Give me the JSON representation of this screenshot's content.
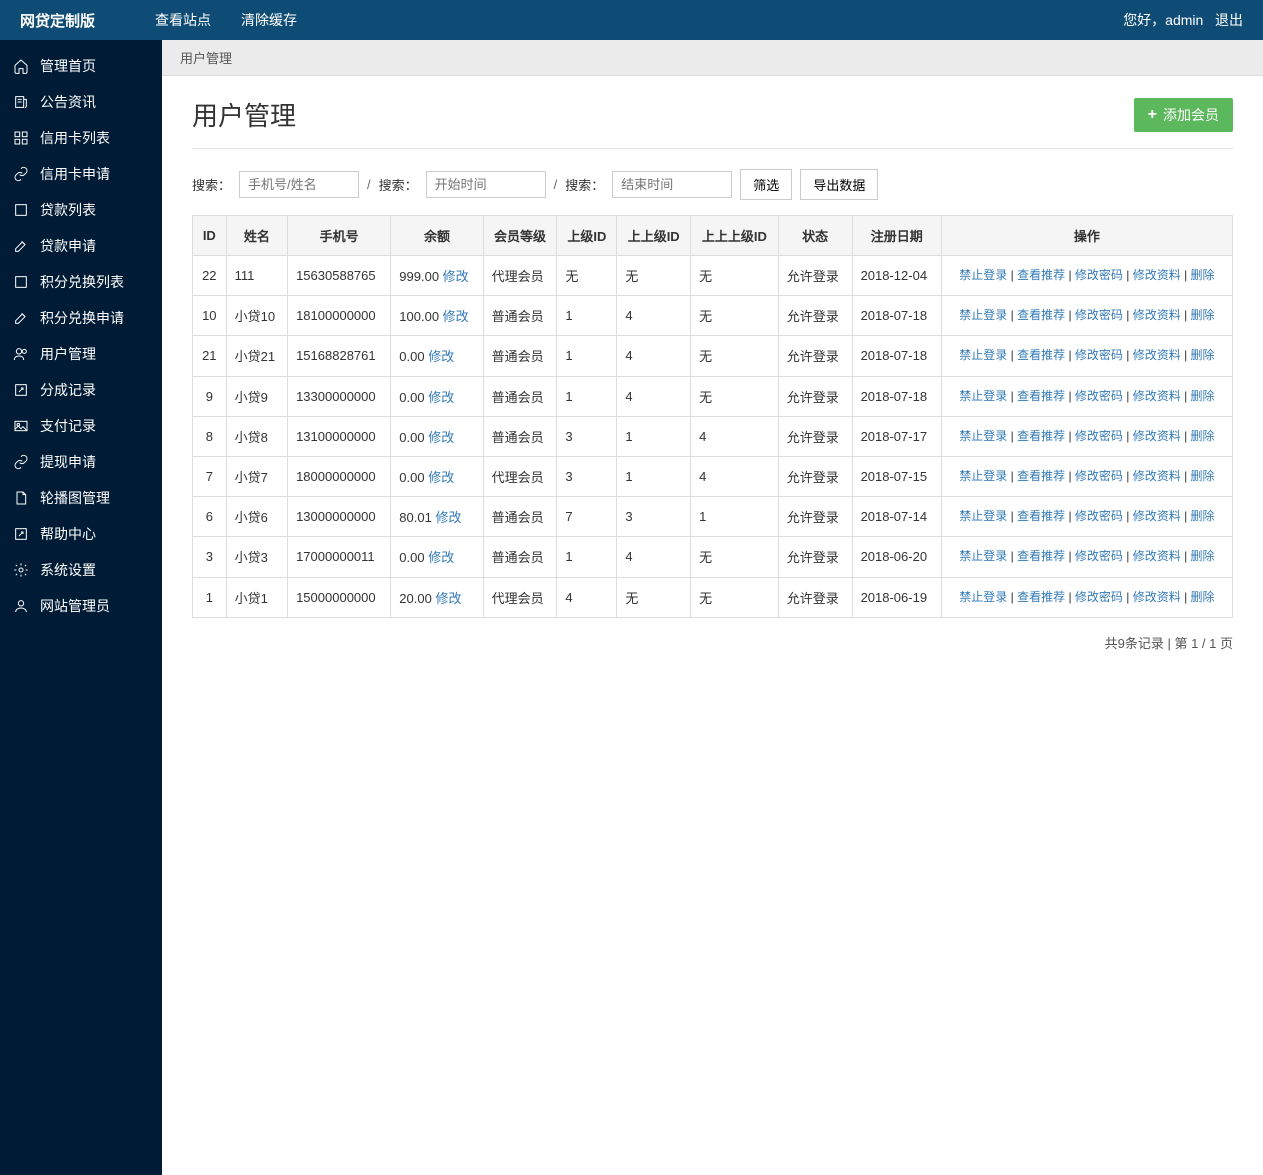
{
  "header": {
    "brand": "网贷定制版",
    "links": [
      "查看站点",
      "清除缓存"
    ],
    "greeting": "您好，admin",
    "logout": "退出"
  },
  "sidebar": {
    "items": [
      {
        "label": "管理首页",
        "icon": "home"
      },
      {
        "label": "公告资讯",
        "icon": "news"
      },
      {
        "label": "信用卡列表",
        "icon": "grid"
      },
      {
        "label": "信用卡申请",
        "icon": "link"
      },
      {
        "label": "贷款列表",
        "icon": "square"
      },
      {
        "label": "贷款申请",
        "icon": "edit"
      },
      {
        "label": "积分兑换列表",
        "icon": "square"
      },
      {
        "label": "积分兑换申请",
        "icon": "edit"
      },
      {
        "label": "用户管理",
        "icon": "users"
      },
      {
        "label": "分成记录",
        "icon": "external"
      },
      {
        "label": "支付记录",
        "icon": "image"
      },
      {
        "label": "提现申请",
        "icon": "link"
      },
      {
        "label": "轮播图管理",
        "icon": "file"
      },
      {
        "label": "帮助中心",
        "icon": "external"
      },
      {
        "label": "系统设置",
        "icon": "gear"
      },
      {
        "label": "网站管理员",
        "icon": "user"
      }
    ]
  },
  "breadcrumb": "用户管理",
  "page": {
    "title": "用户管理",
    "add_button": "添加会员"
  },
  "filter": {
    "search_placeholder": "手机号/姓名",
    "search_prefix": "搜索：",
    "start_placeholder": "开始时间",
    "end_placeholder": "结束时间",
    "filter_btn": "筛选",
    "export_btn": "导出数据"
  },
  "table": {
    "headers": [
      "ID",
      "姓名",
      "手机号",
      "余额",
      "会员等级",
      "上级ID",
      "上上级ID",
      "上上上级ID",
      "状态",
      "注册日期",
      "操作"
    ],
    "modify": "修改",
    "ops": [
      "禁止登录",
      "查看推荐",
      "修改密码",
      "修改资料",
      "删除"
    ],
    "rows": [
      {
        "id": "22",
        "name": "111",
        "phone": "15630588765",
        "balance": "999.00",
        "level": "代理会员",
        "p1": "无",
        "p2": "无",
        "p3": "无",
        "status": "允许登录",
        "date": "2018-12-04"
      },
      {
        "id": "10",
        "name": "小贷10",
        "phone": "18100000000",
        "balance": "100.00",
        "level": "普通会员",
        "p1": "1",
        "p2": "4",
        "p3": "无",
        "status": "允许登录",
        "date": "2018-07-18"
      },
      {
        "id": "21",
        "name": "小贷21",
        "phone": "15168828761",
        "balance": "0.00",
        "level": "普通会员",
        "p1": "1",
        "p2": "4",
        "p3": "无",
        "status": "允许登录",
        "date": "2018-07-18"
      },
      {
        "id": "9",
        "name": "小贷9",
        "phone": "13300000000",
        "balance": "0.00",
        "level": "普通会员",
        "p1": "1",
        "p2": "4",
        "p3": "无",
        "status": "允许登录",
        "date": "2018-07-18"
      },
      {
        "id": "8",
        "name": "小贷8",
        "phone": "13100000000",
        "balance": "0.00",
        "level": "普通会员",
        "p1": "3",
        "p2": "1",
        "p3": "4",
        "status": "允许登录",
        "date": "2018-07-17"
      },
      {
        "id": "7",
        "name": "小贷7",
        "phone": "18000000000",
        "balance": "0.00",
        "level": "代理会员",
        "p1": "3",
        "p2": "1",
        "p3": "4",
        "status": "允许登录",
        "date": "2018-07-15"
      },
      {
        "id": "6",
        "name": "小贷6",
        "phone": "13000000000",
        "balance": "80.01",
        "level": "普通会员",
        "p1": "7",
        "p2": "3",
        "p3": "1",
        "status": "允许登录",
        "date": "2018-07-14"
      },
      {
        "id": "3",
        "name": "小贷3",
        "phone": "17000000011",
        "balance": "0.00",
        "level": "普通会员",
        "p1": "1",
        "p2": "4",
        "p3": "无",
        "status": "允许登录",
        "date": "2018-06-20"
      },
      {
        "id": "1",
        "name": "小贷1",
        "phone": "15000000000",
        "balance": "20.00",
        "level": "代理会员",
        "p1": "4",
        "p2": "无",
        "p3": "无",
        "status": "允许登录",
        "date": "2018-06-19"
      }
    ]
  },
  "pagination": "共9条记录 | 第 1 / 1 页"
}
